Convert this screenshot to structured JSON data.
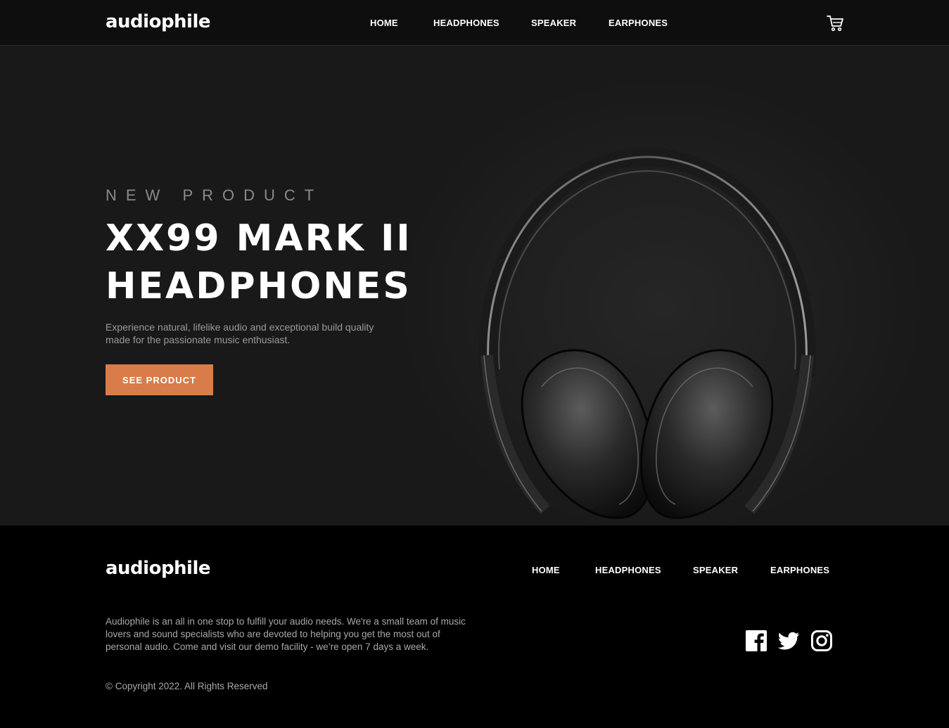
{
  "header": {
    "logo": "audiophile",
    "nav": [
      "HOME",
      "HEADPHONES",
      "SPEAKER",
      "EARPHONES"
    ],
    "cart_icon": "cart-icon"
  },
  "hero": {
    "eyebrow": "NEW PRODUCT",
    "title": "XX99 MARK II HEADPHONES",
    "description": "Experience natural, lifelike audio and exceptional build quality made for the passionate music enthusiast.",
    "cta_label": "SEE PRODUCT",
    "image": "headphones-image"
  },
  "footer": {
    "logo": "audiophile",
    "nav": [
      "HOME",
      "HEADPHONES",
      "SPEAKER",
      "EARPHONES"
    ],
    "description": "Audiophile is an all in one stop to fulfill your audio needs. We're a small team of music lovers and sound specialists who are devoted to helping you get the most out of personal audio. Come and visit our demo facility - we’re open 7 days a week.",
    "copyright": "© Copyright 2022. All Rights Reserved",
    "social_icons": [
      "facebook-icon",
      "twitter-icon",
      "instagram-icon"
    ]
  },
  "colors": {
    "accent": "#D87D4A",
    "header_bg": "#0E0E0E",
    "hero_bg": "#191919",
    "footer_bg": "#000000"
  }
}
